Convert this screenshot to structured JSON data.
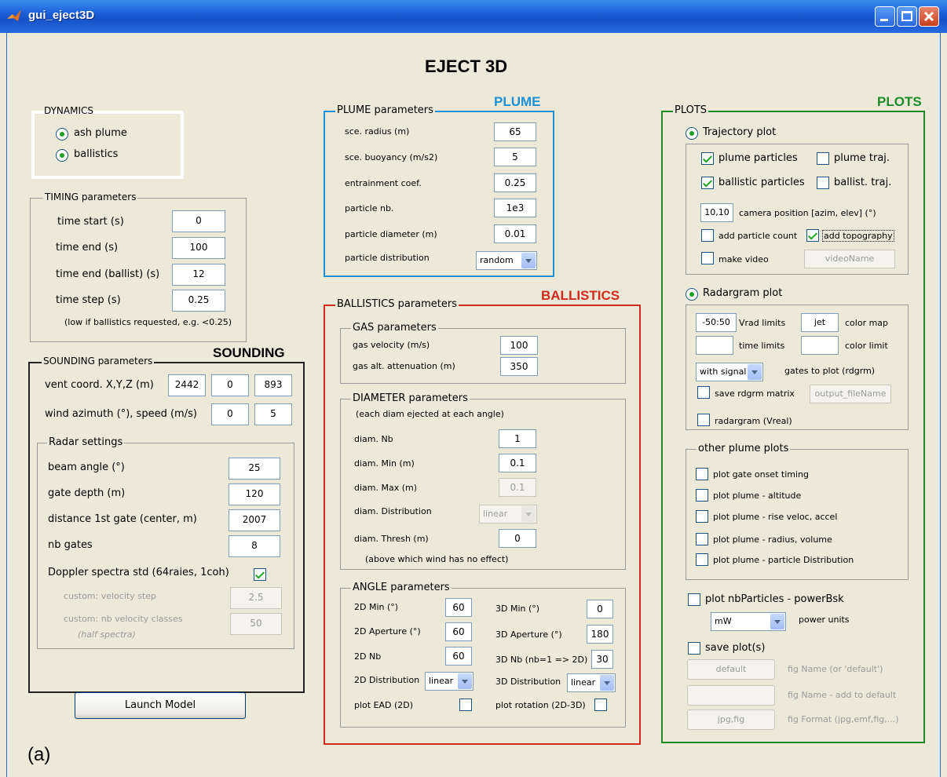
{
  "window": {
    "title": "gui_eject3D"
  },
  "main_title": "EJECT 3D",
  "figure_label": "(a)",
  "colors": {
    "plume": "#1e90d8",
    "ballistics": "#d12a1e",
    "plots": "#1e8c2a",
    "sounding": "#222222"
  },
  "dynamics": {
    "title": "DYNAMICS",
    "ash_plume": "ash plume",
    "ballistics": "ballistics"
  },
  "timing": {
    "title": "TIMING parameters",
    "start_label": "time start (s)",
    "start": "0",
    "end_label": "time end  (s)",
    "end": "100",
    "end_ballist_label": "time end (ballist) (s)",
    "end_ballist": "12",
    "step_label": "time step (s)",
    "step": "0.25",
    "note": "(low if ballistics requested, e.g. <0.25)"
  },
  "sounding": {
    "heading": "SOUNDING",
    "title": "SOUNDING parameters",
    "vent_label": "vent coord. X,Y,Z (m)",
    "vent_x": "2442",
    "vent_y": "0",
    "vent_z": "893",
    "wind_label": "wind azimuth (°), speed (m/s)",
    "wind_az": "0",
    "wind_speed": "5",
    "radar_title": "Radar settings",
    "beam_label": "beam angle (°)",
    "beam": "25",
    "gate_depth_label": "gate depth (m)",
    "gate_depth": "120",
    "dist_label": "distance 1st gate (center, m)",
    "dist": "2007",
    "nb_gates_label": "nb gates",
    "nb_gates": "8",
    "doppler_label": "Doppler spectra std (64raies, 1coh)",
    "vel_step_label": "custom: velocity step",
    "vel_step": "2.5",
    "nb_vel_label": "custom: nb velocity classes",
    "nb_vel_sub": "(half spectra)",
    "nb_vel": "50"
  },
  "launch": "Launch Model",
  "plume": {
    "heading": "PLUME",
    "title": "PLUME parameters",
    "radius_label": "sce. radius (m)",
    "radius": "65",
    "buoy_label": "sce. buoyancy (m/s2)",
    "buoy": "5",
    "entr_label": "entrainment coef.",
    "entr": "0.25",
    "nb_label": "particle nb.",
    "nb": "1e3",
    "diam_label": "particle diameter (m)",
    "diam": "0.01",
    "dist_label": "particle distribution",
    "dist": "random"
  },
  "ballistics": {
    "heading": "BALLISTICS",
    "title": "BALLISTICS parameters",
    "gas_title": "GAS parameters",
    "gas_vel_label": "gas velocity (m/s)",
    "gas_vel": "100",
    "gas_att_label": "gas alt. attenuation (m)",
    "gas_att": "350",
    "diam_title": "DIAMETER parameters",
    "diam_note": "(each diam ejected at each angle)",
    "nb_label": "diam. Nb",
    "nb": "1",
    "min_label": "diam. Min (m)",
    "min": "0.1",
    "max_label": "diam. Max (m)",
    "max": "0.1",
    "distrib_label": "diam. Distribution",
    "distrib": "linear",
    "thresh_label": "diam. Thresh (m)",
    "thresh": "0",
    "thresh_note": "(above which wind has no effect)",
    "angle_title": "ANGLE parameters",
    "min2d_label": "2D Min (°)",
    "min2d": "60",
    "ap2d_label": "2D Aperture (°)",
    "ap2d": "60",
    "nb2d_label": "2D Nb",
    "nb2d": "60",
    "dist2d_label": "2D Distribution",
    "dist2d": "linear",
    "min3d_label": "3D Min (°)",
    "min3d": "0",
    "ap3d_label": "3D Aperture (°)",
    "ap3d": "180",
    "nb3d_label": "3D Nb (nb=1 => 2D)",
    "nb3d": "30",
    "dist3d_label": "3D Distribution",
    "dist3d": "linear",
    "ead_label": "plot EAD (2D)",
    "rot_label": "plot rotation (2D-3D)"
  },
  "plots": {
    "heading": "PLOTS",
    "title": "PLOTS",
    "traj_label": "Trajectory plot",
    "plume_particles": "plume particles",
    "plume_traj": "plume traj.",
    "ballistic_particles": "ballistic particles",
    "ballist_traj": "ballist. traj.",
    "camera": "10,10",
    "camera_label": "camera position [azim, elev] (°)",
    "add_count": "add particle count",
    "add_topo": "add topography",
    "make_video": "make video",
    "video_name": "videoName",
    "radar_label": "Radargram plot",
    "vrad": "-50:50",
    "vrad_label": "Vrad limits",
    "cmap": "jet",
    "cmap_label": "color map",
    "time_limits_label": "time limits",
    "color_limit_label": "color limit",
    "gates": "with signal",
    "gates_label": "gates to plot (rdgrm)",
    "save_rdgrm": "save rdgrm matrix",
    "output_file": "output_fileName",
    "vreal": "radargram (Vreal)",
    "other_title": "other plume plots",
    "onset": "plot gate onset timing",
    "altitude": "plot plume - altitude",
    "rise": "plot plume - rise veloc, accel",
    "radius": "plot plume - radius, volume",
    "distribution": "plot plume - particle Distribution",
    "nbparticles": "plot nbParticles - powerBsk",
    "power_unit": "mW",
    "power_units_label": "power units",
    "save_plots": "save plot(s)",
    "fig_default": "default",
    "fig_name_label": "fig Name (or 'default')",
    "fig_add_label": "fig Name - add to default",
    "fig_format": "jpg,fig",
    "fig_format_label": "fig Format (jpg,emf,fig,...)"
  }
}
